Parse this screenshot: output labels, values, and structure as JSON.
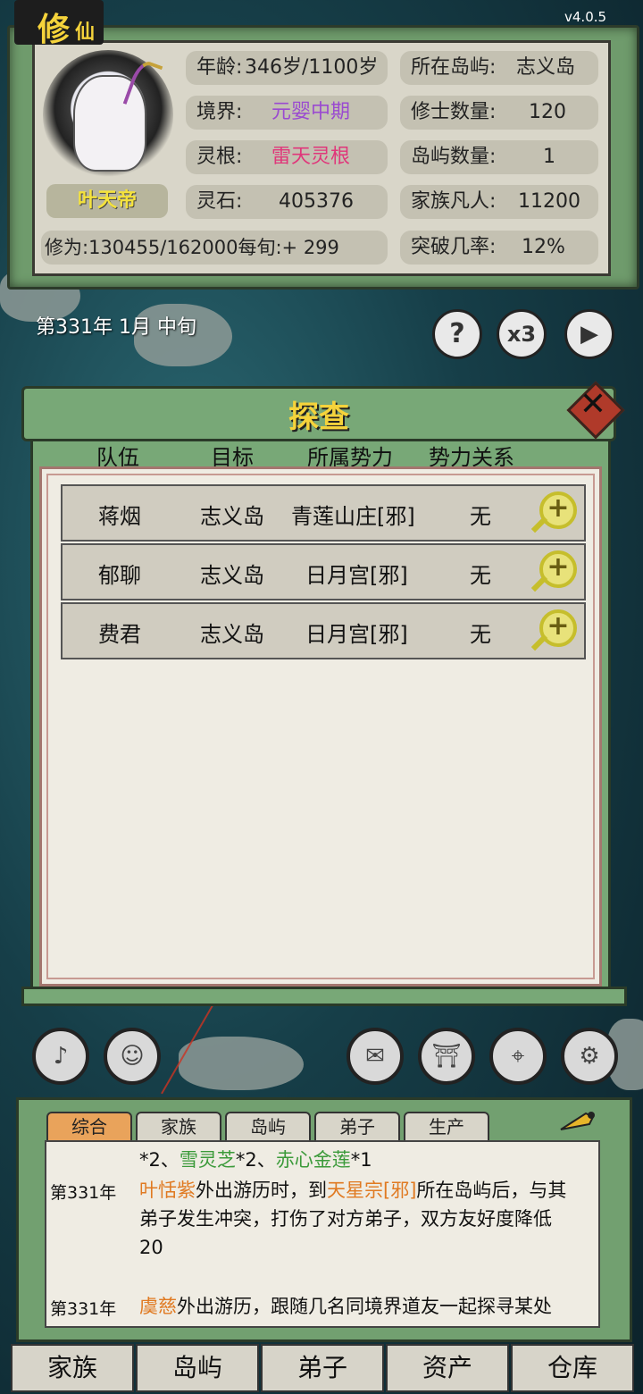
{
  "header": {
    "title_big": "修",
    "title_small": "仙",
    "version": "v4.0.5"
  },
  "player": {
    "name": "叶天帝",
    "age_label": "年龄:",
    "age_value": "346岁/1100岁",
    "realm_label": "境界:",
    "realm_value": "元婴中期",
    "root_label": "灵根:",
    "root_value": "雷天灵根",
    "stones_label": "灵石:",
    "stones_value": "405376",
    "cultivation_text": "修为:130455/162000每旬:+ 299",
    "island_label": "所在岛屿:",
    "island_value": "志义岛",
    "cultivators_label": "修士数量:",
    "cultivators_value": "120",
    "islands_label": "岛屿数量:",
    "islands_value": "1",
    "mortals_label": "家族凡人:",
    "mortals_value": "11200",
    "breakthrough_label": "突破几率:",
    "breakthrough_value": "12%"
  },
  "date": "第331年 1月 中旬",
  "controls": {
    "help": "?",
    "speed": "x3",
    "play": "▶"
  },
  "dialog": {
    "title": "探查",
    "columns": [
      "队伍",
      "目标",
      "所属势力",
      "势力关系"
    ],
    "rows": [
      {
        "team": "蒋烟",
        "target": "志义岛",
        "faction": "青莲山庄[邪]",
        "relation": "无"
      },
      {
        "team": "郁聊",
        "target": "志义岛",
        "faction": "日月宫[邪]",
        "relation": "无"
      },
      {
        "team": "费君",
        "target": "志义岛",
        "faction": "日月宫[邪]",
        "relation": "无"
      }
    ]
  },
  "log": {
    "tabs": [
      "综合",
      "家族",
      "岛屿",
      "弟子",
      "生产"
    ],
    "line0_a": "*2、",
    "line0_b": "雪灵芝",
    "line0_c": "*2、",
    "line0_d": "赤心金莲",
    "line0_e": "*1",
    "entry1_year": "第331年",
    "entry1_name": "叶恬紫",
    "entry1_text_a": "外出游历时，到",
    "entry1_place": "天星宗[邪]",
    "entry1_text_b": "所在岛屿后，与其",
    "entry1_line2": "弟子发生冲突，打伤了对方弟子，双方友好度降低",
    "entry1_line3": "20",
    "entry2_year": "第331年",
    "entry2_name": "虞慈",
    "entry2_text": "外出游历，跟随几名同境界道友一起探寻某处"
  },
  "nav": [
    "家族",
    "岛屿",
    "弟子",
    "资产",
    "仓库"
  ],
  "icons": [
    "horn-icon",
    "person-icon",
    "mail-icon",
    "gate-icon",
    "location-icon",
    "settings-icon"
  ]
}
